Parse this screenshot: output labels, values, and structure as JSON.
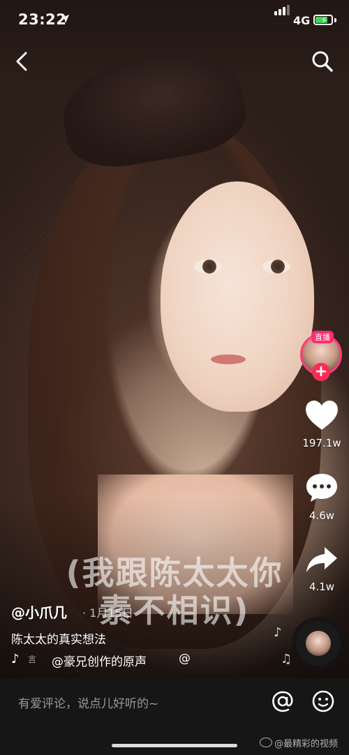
{
  "status_bar": {
    "time": "23:22",
    "network": "4G",
    "battery_level": 0.75,
    "battery_color": "#44d35a"
  },
  "top_bar": {
    "back_icon": "chevron-left-icon",
    "search_icon": "search-icon"
  },
  "right_rail": {
    "live_tag": "直播",
    "follow_symbol": "+",
    "likes": "197.1w",
    "comments": "4.6w",
    "shares": "4.1w"
  },
  "subtitle": {
    "line1": "(我跟陈太太你",
    "line2": "素不相识)"
  },
  "caption": {
    "author": "@小爪几",
    "date": "· 1月15日",
    "description": "陈太太的真实想法",
    "music_partial": "言",
    "music_title": "@豪兄创作的原声",
    "music_at": "@"
  },
  "comment_bar": {
    "placeholder": "有爱评论，说点儿好听的~",
    "watermark": "@最精彩的视频"
  },
  "colors": {
    "like": "#ffffff",
    "follow_badge": "#fe2c55",
    "live_ring": "#ff3b7a"
  }
}
